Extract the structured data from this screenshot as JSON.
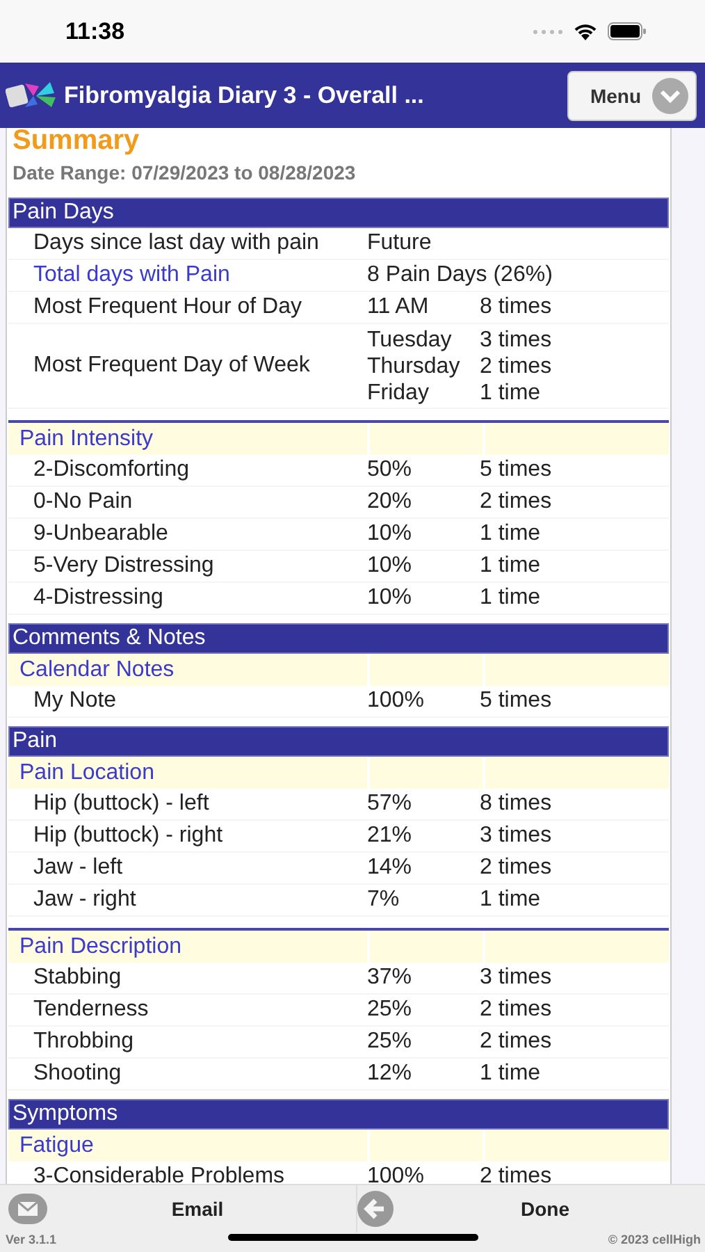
{
  "status_bar": {
    "time": "11:38"
  },
  "app_bar": {
    "title": "Fibromyalgia Diary 3 - Overall ...",
    "menu_button": "Menu"
  },
  "summary": {
    "title": "Summary",
    "date_range": "Date Range: 07/29/2023 to 08/28/2023"
  },
  "sections": [
    {
      "title": "Pain Days",
      "groups": [
        {
          "rows": [
            {
              "kind": "span",
              "label": "Days since last day with pain",
              "value": "Future"
            },
            {
              "kind": "link-span",
              "label": "Total days with Pain",
              "value": "8 Pain Days (26%)"
            },
            {
              "kind": "stat",
              "label": "Most Frequent Hour of Day",
              "share": "11 AM",
              "count": "8 times"
            },
            {
              "kind": "multi",
              "label": "Most Frequent Day of Week",
              "entries": [
                {
                  "share": "Tuesday",
                  "count": "3 times"
                },
                {
                  "share": "Thursday",
                  "count": "2 times"
                },
                {
                  "share": "Friday",
                  "count": "1 time"
                }
              ]
            }
          ]
        },
        {
          "heading": "Pain Intensity",
          "rows": [
            {
              "kind": "stat",
              "label": "2-Discomforting",
              "share": "50%",
              "count": "5 times"
            },
            {
              "kind": "stat",
              "label": "0-No Pain",
              "share": "20%",
              "count": "2 times"
            },
            {
              "kind": "stat",
              "label": "9-Unbearable",
              "share": "10%",
              "count": "1 time"
            },
            {
              "kind": "stat",
              "label": "5-Very Distressing",
              "share": "10%",
              "count": "1 time"
            },
            {
              "kind": "stat",
              "label": "4-Distressing",
              "share": "10%",
              "count": "1 time"
            }
          ]
        }
      ]
    },
    {
      "title": "Comments & Notes",
      "groups": [
        {
          "heading": "Calendar Notes",
          "rows": [
            {
              "kind": "stat",
              "label": "My Note",
              "share": "100%",
              "count": "5 times"
            }
          ]
        }
      ]
    },
    {
      "title": "Pain",
      "groups": [
        {
          "heading": "Pain Location",
          "rows": [
            {
              "kind": "stat",
              "label": "Hip (buttock) - left",
              "share": "57%",
              "count": "8 times"
            },
            {
              "kind": "stat",
              "label": "Hip (buttock) - right",
              "share": "21%",
              "count": "3 times"
            },
            {
              "kind": "stat",
              "label": "Jaw - left",
              "share": "14%",
              "count": "2 times"
            },
            {
              "kind": "stat",
              "label": "Jaw - right",
              "share": "7%",
              "count": "1 time"
            }
          ]
        },
        {
          "heading": "Pain Description",
          "rows": [
            {
              "kind": "stat",
              "label": "Stabbing",
              "share": "37%",
              "count": "3 times"
            },
            {
              "kind": "stat",
              "label": "Tenderness",
              "share": "25%",
              "count": "2 times"
            },
            {
              "kind": "stat",
              "label": "Throbbing",
              "share": "25%",
              "count": "2 times"
            },
            {
              "kind": "stat",
              "label": "Shooting",
              "share": "12%",
              "count": "1 time"
            }
          ]
        }
      ]
    },
    {
      "title": "Symptoms",
      "groups": [
        {
          "heading": "Fatigue",
          "rows": [
            {
              "kind": "stat",
              "label": "3-Considerable Problems",
              "share": "100%",
              "count": "2 times"
            }
          ]
        }
      ]
    }
  ],
  "toolbar": {
    "buttons": [
      {
        "kind": "email",
        "label": "Email"
      },
      {
        "kind": "back",
        "label": "Done"
      }
    ],
    "version": "Ver 3.1.1",
    "copyright": "© 2023 cellHigh"
  }
}
